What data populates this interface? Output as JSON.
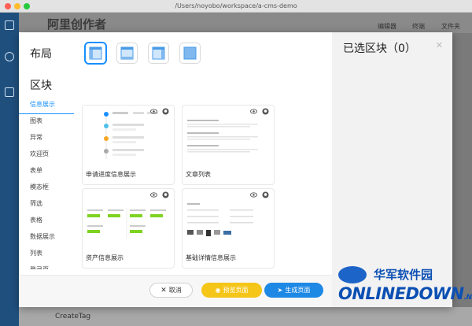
{
  "window": {
    "path": "/Users/noyobo/workspace/a-cms-demo"
  },
  "background_app": {
    "title": "阿里创作者",
    "toolbar_items": [
      "编辑器",
      "终端",
      "文件夹"
    ],
    "bottom_item": "CreateTag"
  },
  "modal": {
    "layout_label": "布局",
    "block_label": "区块",
    "selected_title": "已选区块（0）",
    "close_icon": "close-icon",
    "layouts": [
      {
        "name": "layout-header-aside-content",
        "active": true
      },
      {
        "name": "layout-header-content",
        "active": false
      },
      {
        "name": "layout-aside-content",
        "active": false
      },
      {
        "name": "layout-blank",
        "active": false
      }
    ],
    "categories": [
      "信息展示",
      "图表",
      "异常",
      "欢迎页",
      "表单",
      "模态框",
      "筛选",
      "表格",
      "数据展示",
      "列表",
      "登录页"
    ],
    "active_category": "信息展示",
    "cards": [
      {
        "title": "申请进度信息展示",
        "preview": "timeline-preview"
      },
      {
        "title": "文章列表",
        "preview": "article-list-preview"
      },
      {
        "title": "资产信息展示",
        "preview": "asset-preview"
      },
      {
        "title": "基础详情信息展示",
        "preview": "detail-preview"
      }
    ],
    "buttons": {
      "cancel": "取消",
      "preview": "预览页面",
      "generate": "生成页面"
    }
  },
  "watermark": {
    "line1": "华军软件园",
    "line2": "ONLINEDOWN",
    "suffix": ".NET"
  },
  "colors": {
    "accent": "#1890ff",
    "preview_button": "#f5c518",
    "generate_button": "#1e88e5",
    "sidebar_bg": "#1f4f7d"
  }
}
